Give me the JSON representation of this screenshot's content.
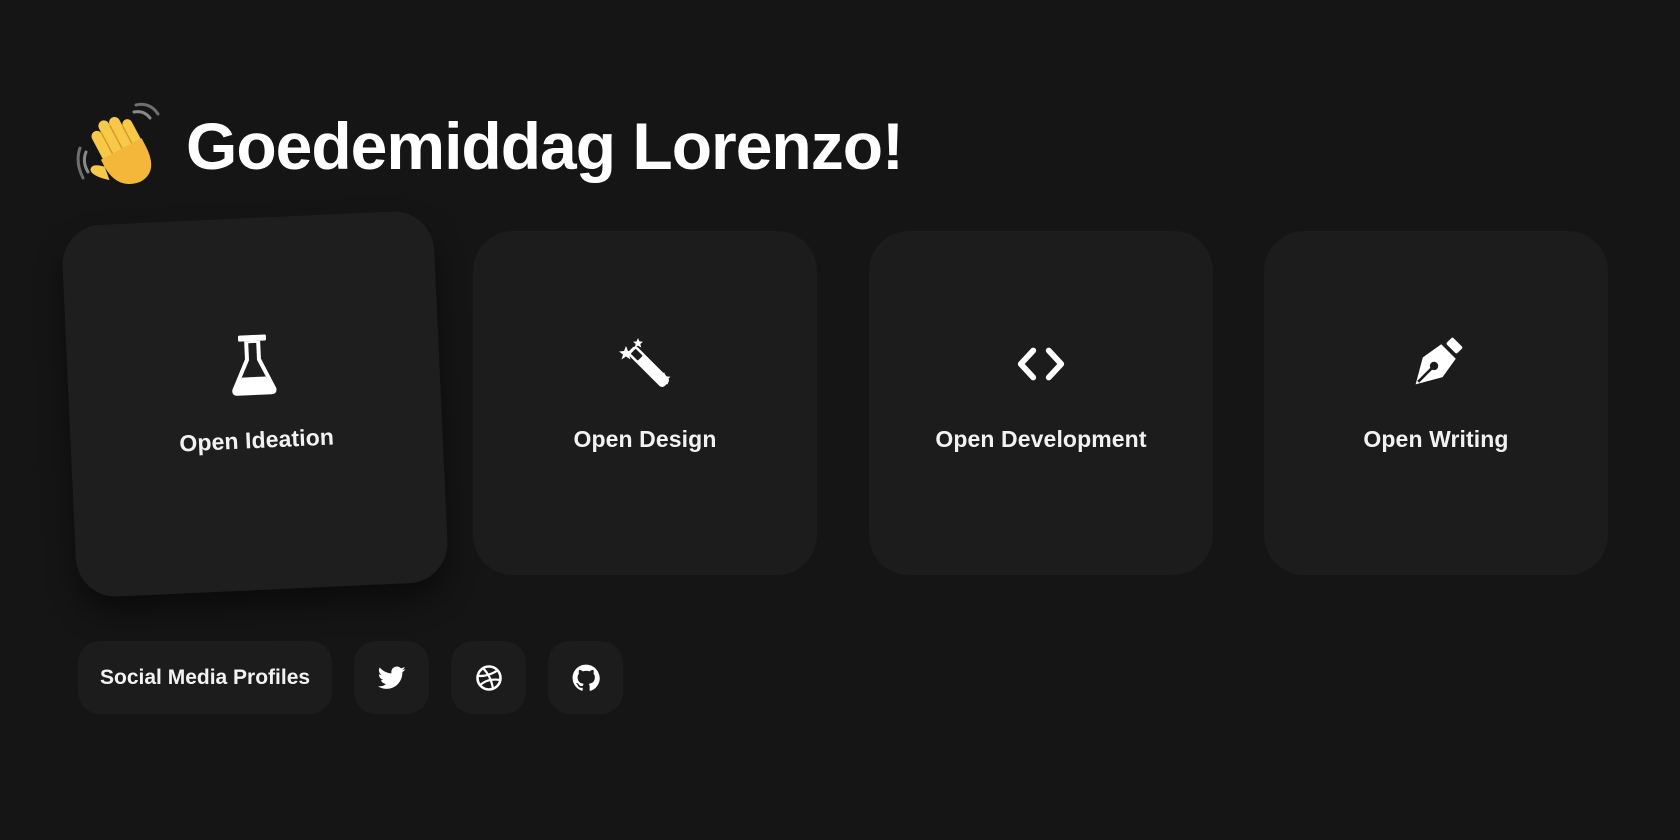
{
  "greeting": {
    "emoji_icon": "waving-hand-icon",
    "title": "Goedemiddag Lorenzo!"
  },
  "cards": [
    {
      "icon": "flask-icon",
      "label": "Open Ideation"
    },
    {
      "icon": "magic-wand-icon",
      "label": "Open Design"
    },
    {
      "icon": "code-icon",
      "label": "Open Development"
    },
    {
      "icon": "pen-nib-icon",
      "label": "Open Writing"
    }
  ],
  "socials": {
    "label": "Social Media Profiles",
    "links": [
      {
        "icon": "twitter-icon"
      },
      {
        "icon": "dribbble-icon"
      },
      {
        "icon": "github-icon"
      }
    ]
  },
  "colors": {
    "background": "#151515",
    "card": "#1c1c1c",
    "text": "#ffffff",
    "emoji_skin": "#f7c948"
  }
}
